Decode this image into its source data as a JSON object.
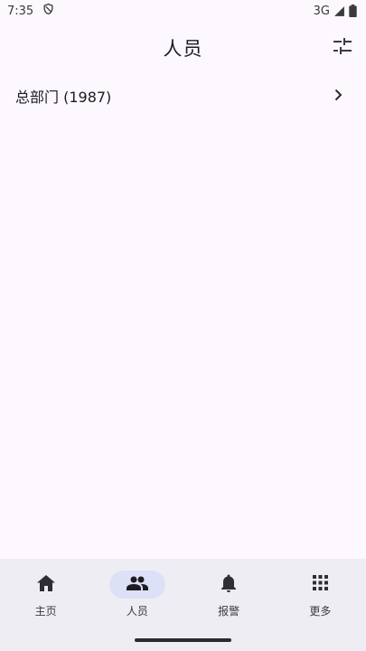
{
  "status_bar": {
    "time": "7:35",
    "network": "3G",
    "icons": [
      "shield-icon",
      "signal-icon",
      "battery-icon"
    ]
  },
  "app_bar": {
    "title": "人员",
    "action_icon": "tune-filter-icon"
  },
  "list": {
    "items": [
      {
        "label": "总部门 (1987)",
        "icon": "chevron-right-icon"
      }
    ]
  },
  "bottom_nav": {
    "items": [
      {
        "label": "主页",
        "icon": "home-icon",
        "active": false
      },
      {
        "label": "人员",
        "icon": "people-icon",
        "active": true
      },
      {
        "label": "报警",
        "icon": "bell-icon",
        "active": false
      },
      {
        "label": "更多",
        "icon": "apps-grid-icon",
        "active": false
      }
    ]
  },
  "colors": {
    "background": "#FCF8FE",
    "nav_background": "#EFEDF4",
    "active_indicator": "#DDE1F7",
    "text": "#1C1B1F"
  }
}
